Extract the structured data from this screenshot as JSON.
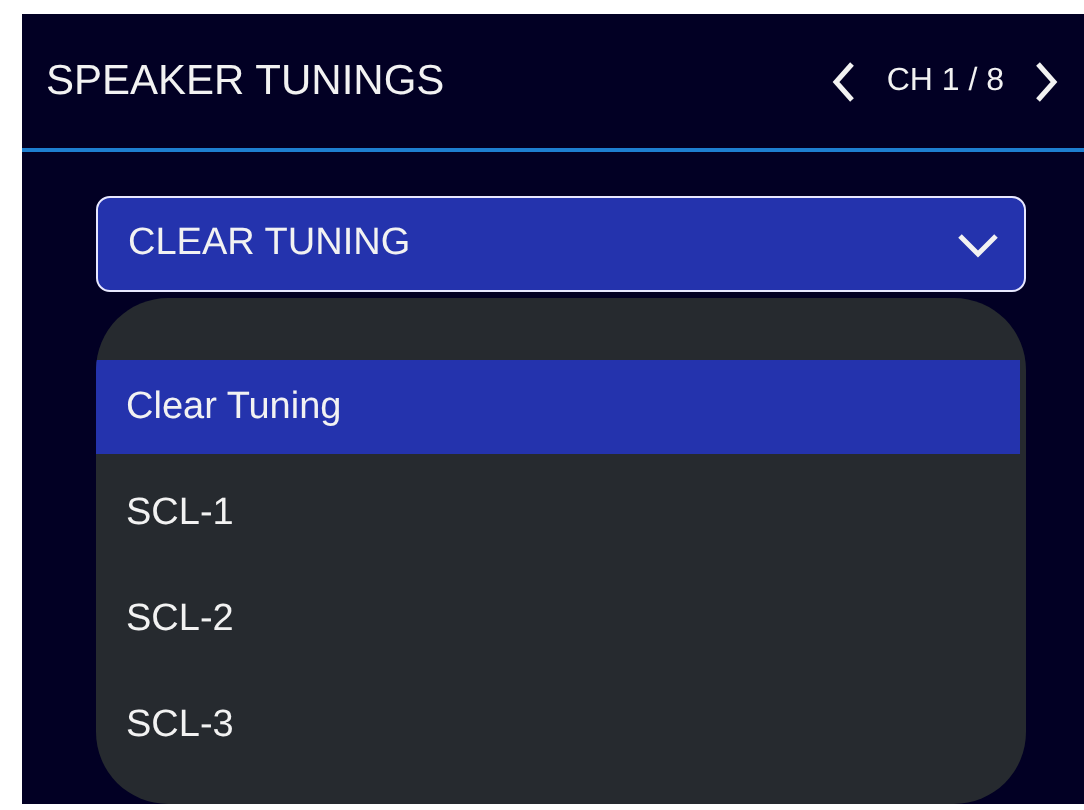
{
  "header": {
    "title": "SPEAKER TUNINGS",
    "channel": "CH 1 / 8"
  },
  "dropdown": {
    "value": "CLEAR TUNING",
    "expanded": true
  },
  "options": [
    {
      "label": "Clear Tuning",
      "selected": true
    },
    {
      "label": "SCL-1",
      "selected": false
    },
    {
      "label": "SCL-2",
      "selected": false
    },
    {
      "label": "SCL-3",
      "selected": false
    }
  ]
}
